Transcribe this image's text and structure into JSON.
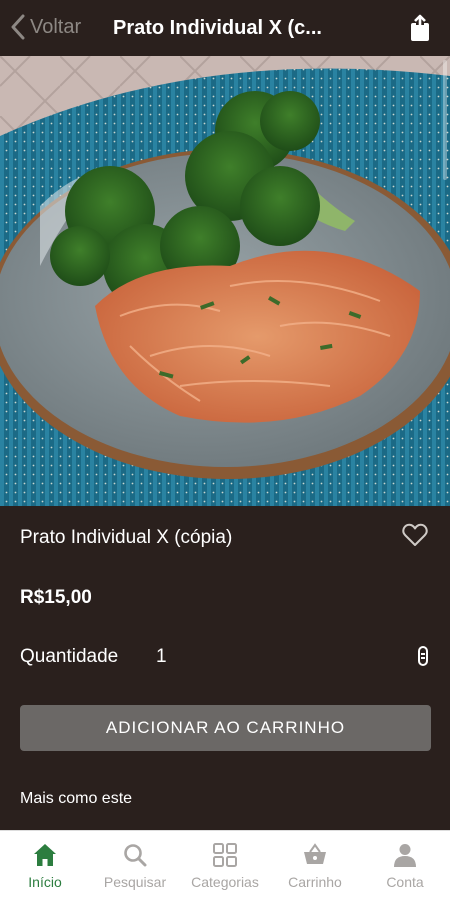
{
  "header": {
    "back_label": "Voltar",
    "title": "Prato Individual X (c..."
  },
  "product": {
    "name": "Prato Individual X (cópia)",
    "price": "R$15,00",
    "quantity_label": "Quantidade",
    "quantity_value": "1",
    "add_to_cart_label": "ADICIONAR AO CARRINHO",
    "more_like_this": "Mais como este"
  },
  "tabbar": {
    "items": [
      {
        "label": "Início",
        "icon": "home-icon",
        "active": true
      },
      {
        "label": "Pesquisar",
        "icon": "search-icon",
        "active": false
      },
      {
        "label": "Categorias",
        "icon": "grid-icon",
        "active": false
      },
      {
        "label": "Carrinho",
        "icon": "basket-icon",
        "active": false
      },
      {
        "label": "Conta",
        "icon": "user-icon",
        "active": false
      }
    ]
  },
  "colors": {
    "background": "#2a201d",
    "accent_active": "#2c7d3f",
    "button_bg": "#6b6866"
  }
}
